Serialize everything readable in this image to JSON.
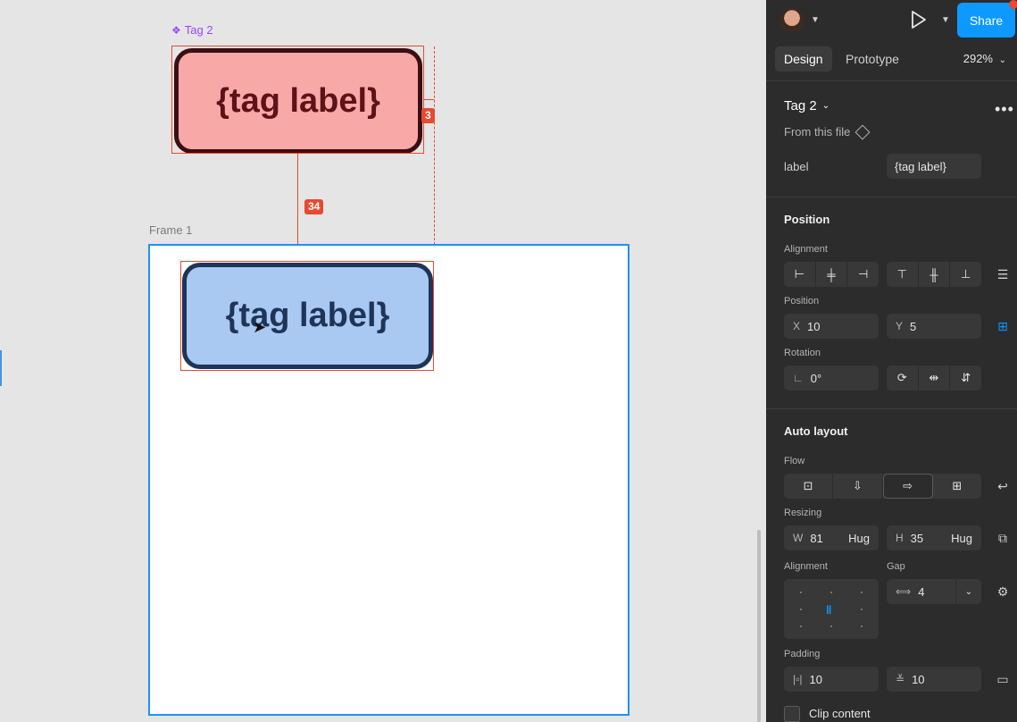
{
  "canvas": {
    "component_label": "Tag 2",
    "tag_text_top": "{tag label}",
    "tag_text_frame": "{tag label}",
    "measure_right": "3",
    "measure_gap": "34",
    "frame_label": "Frame 1"
  },
  "topbar": {
    "share_label": "Share"
  },
  "tabs": {
    "design": "Design",
    "prototype": "Prototype",
    "zoom": "292%"
  },
  "component": {
    "name": "Tag 2",
    "source": "From this file",
    "prop_label": "label",
    "prop_value": "{tag label}"
  },
  "position": {
    "title": "Position",
    "alignment_label": "Alignment",
    "position_label": "Position",
    "x_prefix": "X",
    "x_value": "10",
    "y_prefix": "Y",
    "y_value": "5",
    "rotation_label": "Rotation",
    "rotation_value": "0°"
  },
  "auto_layout": {
    "title": "Auto layout",
    "flow_label": "Flow",
    "resizing_label": "Resizing",
    "w_prefix": "W",
    "w_value": "81",
    "w_mode": "Hug",
    "h_prefix": "H",
    "h_value": "35",
    "h_mode": "Hug",
    "alignment_label": "Alignment",
    "gap_label": "Gap",
    "gap_value": "4",
    "padding_label": "Padding",
    "padding_h": "10",
    "padding_v": "10",
    "clip_label": "Clip content"
  },
  "colors": {
    "accent": "#0d99ff",
    "measure": "#e8492f",
    "component": "#9747ff"
  }
}
